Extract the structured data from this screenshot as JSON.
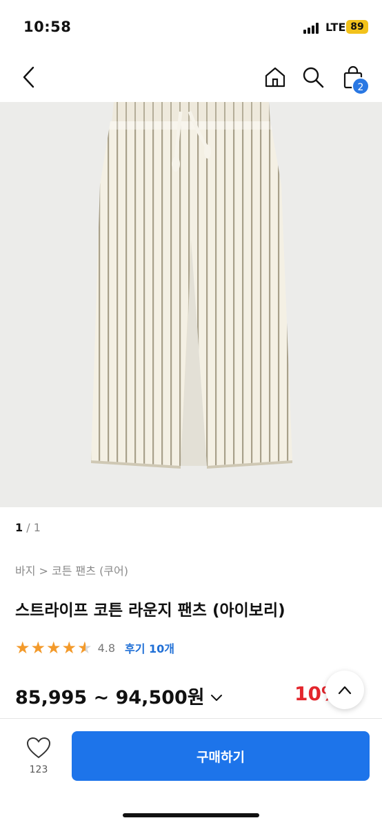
{
  "status_bar": {
    "time": "10:58",
    "network": "LTE",
    "battery": "89"
  },
  "header": {
    "cart_count": "2"
  },
  "gallery": {
    "current": "1",
    "total": "/ 1"
  },
  "product": {
    "breadcrumb": "바지 > 코튼 팬츠 (쿠어)",
    "title": "스트라이프 코튼 라운지 팬츠 (아이보리)",
    "rating": "4.8",
    "stars": 4.5,
    "reviews": "후기 10개",
    "price": "85,995 ~ 94,500원",
    "discount": "10%"
  },
  "bottom": {
    "like_count": "123",
    "buy_label": "구매하기"
  },
  "colors": {
    "accent": "#1d74ea",
    "star": "#f39a2b",
    "discount": "#e3262d",
    "battery": "#f2c21b"
  }
}
